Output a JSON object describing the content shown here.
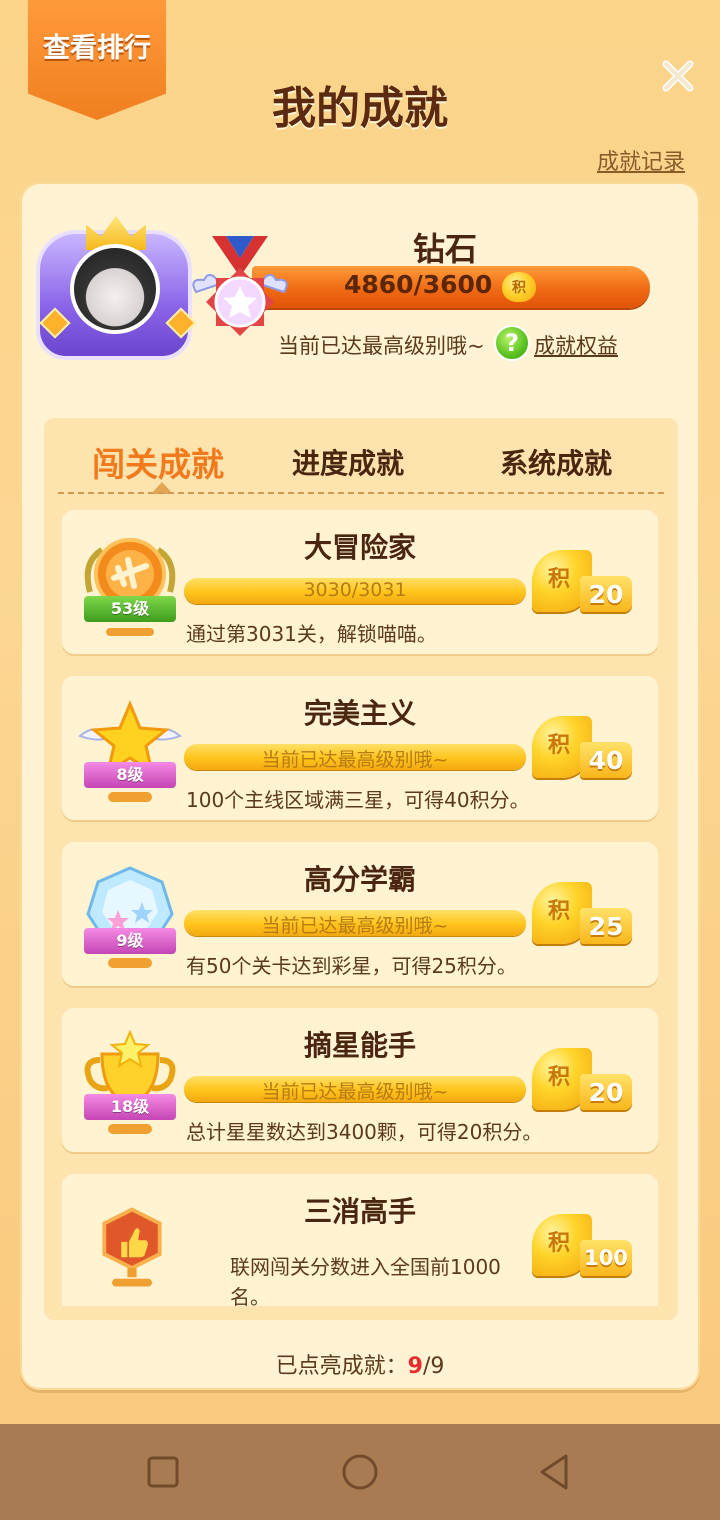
{
  "header": {
    "ranking_button": "查看排行",
    "title": "我的成就",
    "record_link": "成就记录"
  },
  "profile": {
    "rank_name": "钻石",
    "points_progress": "4860/3600",
    "points_icon": "积",
    "max_level_hint": "当前已达最高级别哦~",
    "benefit_link": "成就权益",
    "help_icon": "?"
  },
  "tabs": [
    {
      "label": "闯关成就",
      "active": true
    },
    {
      "label": "进度成就",
      "active": false
    },
    {
      "label": "系统成就",
      "active": false
    }
  ],
  "achievements": [
    {
      "title": "大冒险家",
      "progress_text": "3030/3031",
      "progress_fraction": 0.9997,
      "level": "53级",
      "description": "通过第3031关，解锁喵喵。",
      "reward_icon": "积",
      "reward": "20",
      "badge_icon": "airplane-medal-icon"
    },
    {
      "title": "完美主义",
      "progress_text": "当前已达最高级别哦~",
      "progress_fraction": 1,
      "level": "8级",
      "description": "100个主线区域满三星，可得40积分。",
      "reward_icon": "积",
      "reward": "40",
      "badge_icon": "winged-star-icon"
    },
    {
      "title": "高分学霸",
      "progress_text": "当前已达最高级别哦~",
      "progress_fraction": 1,
      "level": "9级",
      "description": "有50个关卡达到彩星，可得25积分。",
      "reward_icon": "积",
      "reward": "25",
      "badge_icon": "crystal-gem-icon"
    },
    {
      "title": "摘星能手",
      "progress_text": "当前已达最高级别哦~",
      "progress_fraction": 1,
      "level": "18级",
      "description": "总计星星数达到3400颗，可得20积分。",
      "reward_icon": "积",
      "reward": "20",
      "badge_icon": "star-trophy-icon"
    },
    {
      "title": "三消高手",
      "description": "联网闯关分数进入全国前1000名。",
      "reward_icon": "积",
      "reward": "100",
      "badge_icon": "thumbs-up-trophy-icon"
    }
  ],
  "footer": {
    "label": "已点亮成就：",
    "lit_count": "9",
    "total": "/9"
  },
  "colors": {
    "accent_orange": "#f07a1c",
    "bar_orange": "#f06a13",
    "progress_gold": "#ffc41a",
    "lit_red": "#e62c2c"
  }
}
